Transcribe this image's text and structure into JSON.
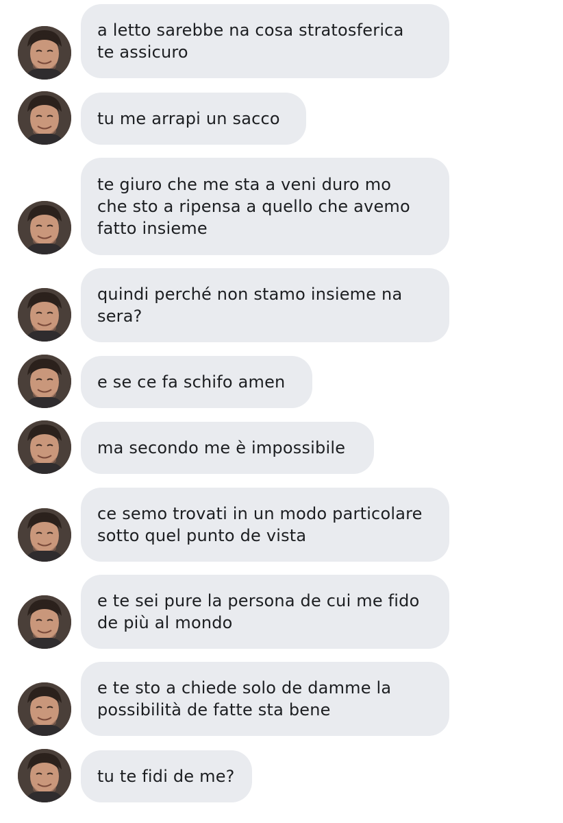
{
  "messages": [
    {
      "text": "a letto sarebbe na cosa stratosferica\nte assicuro"
    },
    {
      "text": "tu me arrapi un sacco"
    },
    {
      "text": "te giuro che me sta a veni duro mo\nche sto a ripensa a quello che avemo\nfatto insieme"
    },
    {
      "text": "quindi perché non stamo insieme na\nsera?"
    },
    {
      "text": "e se ce fa schifo amen"
    },
    {
      "text": "ma secondo me è impossibile"
    },
    {
      "text": "ce semo trovati in un modo particolare\nsotto quel punto de vista"
    },
    {
      "text": "e te sei pure la persona de cui me fido\nde più al mondo"
    },
    {
      "text": "e te sto a chiede solo de damme la\npossibilità de fatte sta bene"
    },
    {
      "text": "tu te fidi de me?"
    }
  ],
  "colors": {
    "bubble": "#e9ebef",
    "text": "#1c1e21",
    "background": "#ffffff"
  },
  "icons": {
    "avatar": "profile-photo-avatar"
  }
}
